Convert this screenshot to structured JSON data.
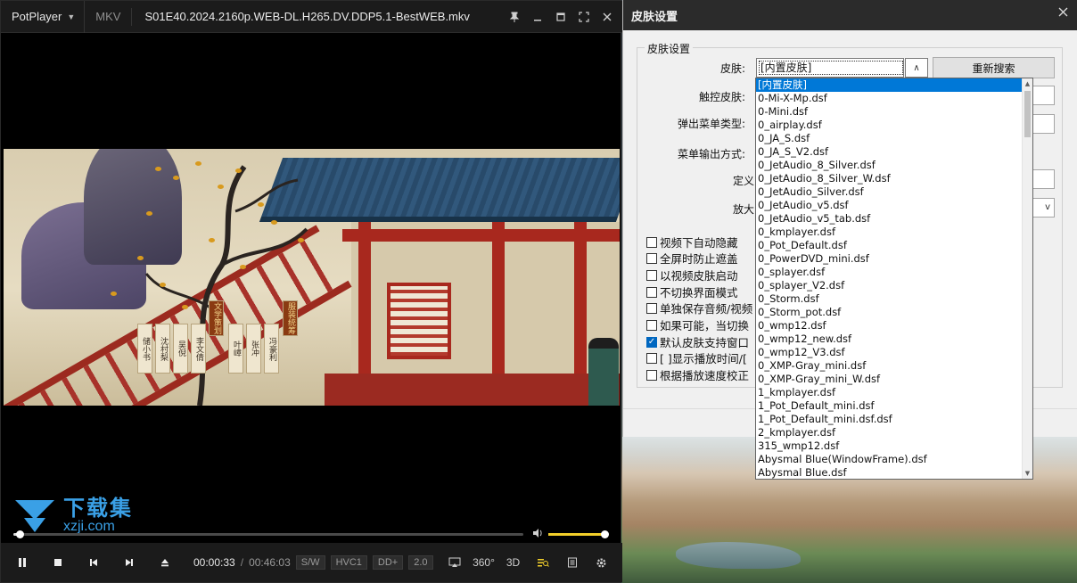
{
  "player": {
    "app_name": "PotPlayer",
    "format": "MKV",
    "filename": "S01E40.2024.2160p.WEB-DL.H265.DV.DDP5.1-BestWEB.mkv",
    "current_time": "00:00:33",
    "separator": "/",
    "duration": "00:46:03",
    "tags": [
      "S/W",
      "HVC1",
      "DD+",
      "2.0"
    ],
    "seek_progress": 0.012,
    "volume_level": 1.0,
    "video_subtitles": [
      "储小书",
      "沈村梨",
      "吴倪",
      "李文倩",
      "叶嶂",
      "张冲",
      "冯豪利"
    ],
    "video_red_subtitles": [
      "文学策划",
      "服装统筹"
    ],
    "right_tools": [
      "360°",
      "3D"
    ]
  },
  "watermark": {
    "cn": "下载集",
    "en": "xzji.com"
  },
  "dialog": {
    "title": "皮肤设置",
    "group_label": "皮肤设置",
    "labels": {
      "skin": "皮肤:",
      "touch_skin": "触控皮肤:",
      "popup_menu_type": "弹出菜单类型:",
      "menu_output": "菜单输出方式:",
      "define": "定义",
      "zoom": "放大"
    },
    "skin_value": "[内置皮肤]",
    "rescan_button": "重新搜索",
    "checkboxes": [
      {
        "label": "视频下自动隐藏",
        "checked": false
      },
      {
        "label": "全屏时防止遮盖",
        "checked": false
      },
      {
        "label": "以视频皮肤启动",
        "checked": false
      },
      {
        "label": "不切换界面模式",
        "checked": false
      },
      {
        "label": "单独保存音频/视频",
        "checked": false
      },
      {
        "label": "如果可能，当切换",
        "checked": false
      },
      {
        "label": "默认皮肤支持窗口",
        "checked": true
      },
      {
        "label": "[ ]显示播放时间/[",
        "checked": false
      },
      {
        "label": "根据播放速度校正",
        "checked": false
      }
    ],
    "skin_options": [
      "[内置皮肤]",
      "0-Mi-X-Mp.dsf",
      "0-Mini.dsf",
      "0_airplay.dsf",
      "0_JA_S.dsf",
      "0_JA_S_V2.dsf",
      "0_JetAudio_8_Silver.dsf",
      "0_JetAudio_8_Silver_W.dsf",
      "0_JetAudio_Silver.dsf",
      "0_JetAudio_v5.dsf",
      "0_JetAudio_v5_tab.dsf",
      "0_kmplayer.dsf",
      "0_Pot_Default.dsf",
      "0_PowerDVD_mini.dsf",
      "0_splayer.dsf",
      "0_splayer_V2.dsf",
      "0_Storm.dsf",
      "0_Storm_pot.dsf",
      "0_wmp12.dsf",
      "0_wmp12_new.dsf",
      "0_wmp12_V3.dsf",
      "0_XMP-Gray_mini.dsf",
      "0_XMP-Gray_mini_W.dsf",
      "1_kmplayer.dsf",
      "1_Pot_Default_mini.dsf",
      "1_Pot_Default_mini.dsf.dsf",
      "2_kmplayer.dsf",
      "315_wmp12.dsf",
      "Abysmal Blue(WindowFrame).dsf",
      "Abysmal Blue.dsf"
    ]
  }
}
